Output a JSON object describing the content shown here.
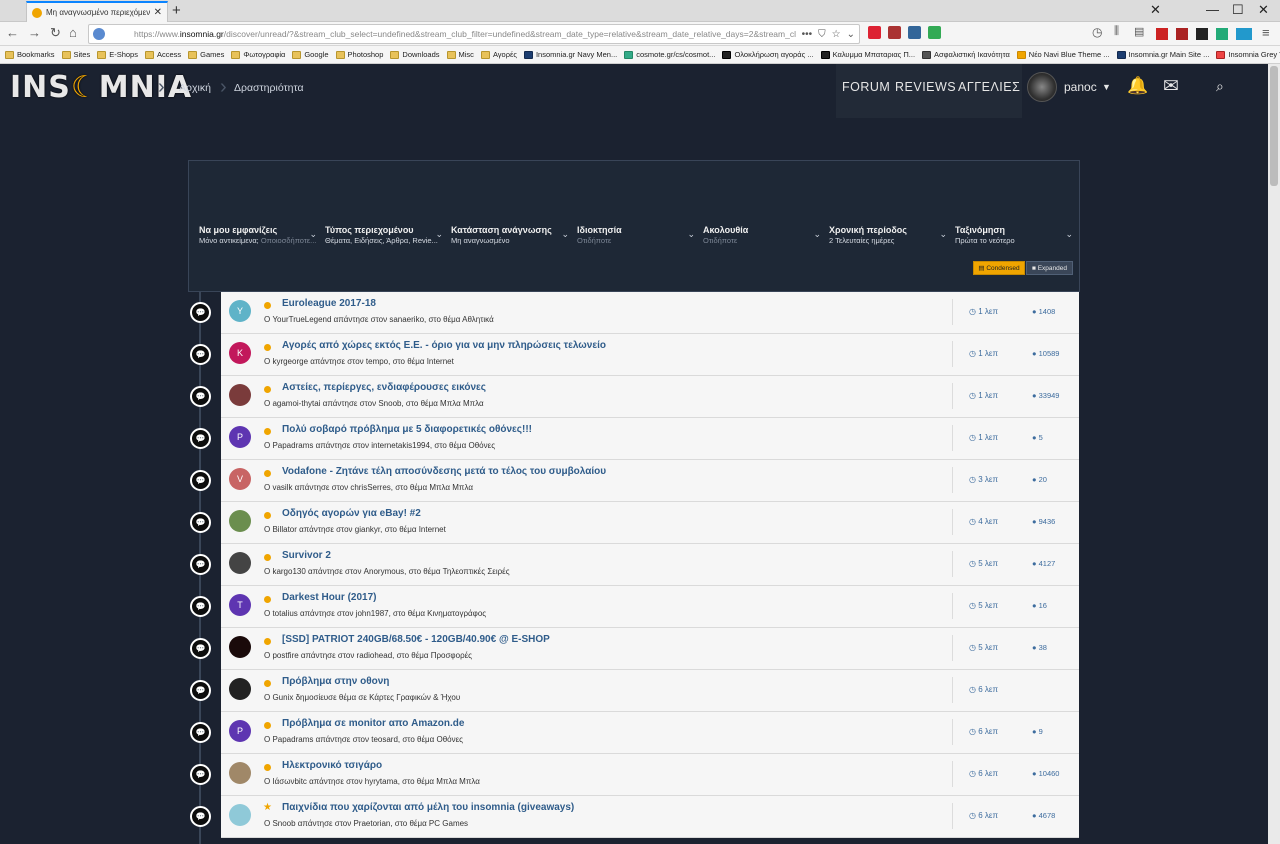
{
  "browser": {
    "tab_title": "Μη αναγνωσμένο περιεχόμενο - Insomnia",
    "url_prefix": "https://www.",
    "url_domain": "insomnia.gr",
    "url_rest": "/discover/unread/?&stream_club_select=undefined&stream_club_filter=undefined&stream_date_type=relative&stream_date_relative_days=2&stream_cl...",
    "bookmarks": [
      "Bookmarks",
      "Sites",
      "E-Shops",
      "Access",
      "Games",
      "Φωτογραφία",
      "Google",
      "Photoshop",
      "Downloads",
      "Misc",
      "Αγορές",
      "Insomnia.gr Navy Men...",
      "cosmote.gr/cs/cosmot...",
      "Ολοκλήρωση αγοράς ...",
      "Καλυμμα Μπαταριας Π...",
      "Ασφαλιστική Ικανότητα",
      "Νέο Navi Blue Theme ...",
      "Insomnia.gr Main Site ...",
      "Insomnia Grey Theme ..."
    ]
  },
  "header": {
    "logo_a": "INS",
    "logo_o": "☾",
    "logo_b": "MNIA",
    "breadcrumbs": [
      "Αρχική",
      "Δραστηριότητα"
    ],
    "nav": [
      "FORUM",
      "REVIEWS",
      "ΑΓΓΕΛΙΕΣ"
    ],
    "username": "panoc"
  },
  "filters": [
    {
      "title": "Να μου εμφανίζεις",
      "value": "Μόνο αντικείμενα;",
      "dim": " Οποιοσδήποτε..."
    },
    {
      "title": "Τύπος περιεχομένου",
      "value": "Θέματα, Ειδήσεις, Άρθρα, Revie...",
      "dim": ""
    },
    {
      "title": "Κατάσταση ανάγνωσης",
      "value": "Μη αναγνωσμένο",
      "dim": ""
    },
    {
      "title": "Ιδιοκτησία",
      "value": "",
      "dim": "Οτιδήποτε"
    },
    {
      "title": "Ακολουθία",
      "value": "",
      "dim": "Οτιδήποτε"
    },
    {
      "title": "Χρονική περίοδος",
      "value": "2 Τελευταίες ημέρες",
      "dim": ""
    },
    {
      "title": "Ταξινόμηση",
      "value": "Πρώτα το νεότερο",
      "dim": ""
    }
  ],
  "view_buttons": {
    "condensed": "Condensed",
    "expanded": "Expanded"
  },
  "rows": [
    {
      "avatar": "Y",
      "avatar_color": "#5fb3c8",
      "title": "Euroleague 2017-18",
      "sub": "Ο YourTrueLegend απάντησε στον sanaeriko, στο θέμα Αθλητικά",
      "time": "1 λεπ",
      "count": "1408",
      "marker": "dot"
    },
    {
      "avatar": "K",
      "avatar_color": "#c2185b",
      "title": "Αγορές από χώρες εκτός Ε.Ε. - όριο για να μην πληρώσεις τελωνείο",
      "sub": "Ο kyrgeorge απάντησε στον tempo, στο θέμα Internet",
      "time": "1 λεπ",
      "count": "10589",
      "marker": "dot"
    },
    {
      "avatar": "",
      "avatar_color": "#7a3b3b",
      "title": "Αστείες, περίεργες, ενδιαφέρουσες εικόνες",
      "sub": "Ο agamoi-thytai απάντησε στον Snoob, στο θέμα Μπλα Μπλα",
      "time": "1 λεπ",
      "count": "33949",
      "marker": "dot"
    },
    {
      "avatar": "P",
      "avatar_color": "#5e35b1",
      "title": "Πολύ σοβαρό πρόβλημα με 5 διαφορετικές οθόνες!!!",
      "sub": "Ο Papadrams απάντησε στον internetakis1994, στο θέμα Οθόνες",
      "time": "1 λεπ",
      "count": "5",
      "marker": "dot"
    },
    {
      "avatar": "V",
      "avatar_color": "#c86464",
      "title": "Vodafone - Ζητάνε τέλη αποσύνδεσης μετά το τέλος του συμβολαίου",
      "sub": "Ο vasilk απάντησε στον chrisSerres, στο θέμα Μπλα Μπλα",
      "time": "3 λεπ",
      "count": "20",
      "marker": "dot"
    },
    {
      "avatar": "",
      "avatar_color": "#6b8e4e",
      "title": "Οδηγός αγορών για eBay! #2",
      "sub": "Ο Billator απάντησε στον giankyr, στο θέμα Internet",
      "time": "4 λεπ",
      "count": "9436",
      "marker": "dot"
    },
    {
      "avatar": "",
      "avatar_color": "#444444",
      "title": "Survivor 2",
      "sub": "Ο kargo130 απάντησε στον Anorymous, στο θέμα Τηλεοπτικές Σειρές",
      "time": "5 λεπ",
      "count": "4127",
      "marker": "dot"
    },
    {
      "avatar": "T",
      "avatar_color": "#5e35b1",
      "title": "Darkest Hour (2017)",
      "sub": "Ο totalius απάντησε στον john1987, στο θέμα Κινηματογράφος",
      "time": "5 λεπ",
      "count": "16",
      "marker": "dot"
    },
    {
      "avatar": "",
      "avatar_color": "#1a0a0a",
      "title": "[SSD] PATRIOT 240GB/68.50€ - 120GB/40.90€ @ E-SHOP",
      "sub": "Ο postfire απάντησε στον radiohead, στο θέμα Προσφορές",
      "time": "5 λεπ",
      "count": "38",
      "marker": "dot"
    },
    {
      "avatar": "",
      "avatar_color": "#222222",
      "title": "Πρόβλημα στην οθονη",
      "sub": "Ο Gunix δημοσίευσε θέμα σε Κάρτες Γραφικών & Ήχου",
      "time": "6 λεπ",
      "count": "",
      "marker": "dot"
    },
    {
      "avatar": "P",
      "avatar_color": "#5e35b1",
      "title": "Πρόβλημα σε monitor απο Amazon.de",
      "sub": "Ο Papadrams απάντησε στον teosard, στο θέμα Οθόνες",
      "time": "6 λεπ",
      "count": "9",
      "marker": "dot"
    },
    {
      "avatar": "",
      "avatar_color": "#a08868",
      "title": "Ηλεκτρονικό τσιγάρο",
      "sub": "Ο Ιάσωνbitc απάντησε στον hyrytama, στο θέμα Μπλα Μπλα",
      "time": "6 λεπ",
      "count": "10460",
      "marker": "dot"
    },
    {
      "avatar": "",
      "avatar_color": "#8fc9d8",
      "title": "Παιχνίδια που χαρίζονται από μέλη του insomnia (giveaways)",
      "sub": "Ο Snoob απάντησε στον Praetorian, στο θέμα PC Games",
      "time": "6 λεπ",
      "count": "4678",
      "marker": "star"
    }
  ]
}
